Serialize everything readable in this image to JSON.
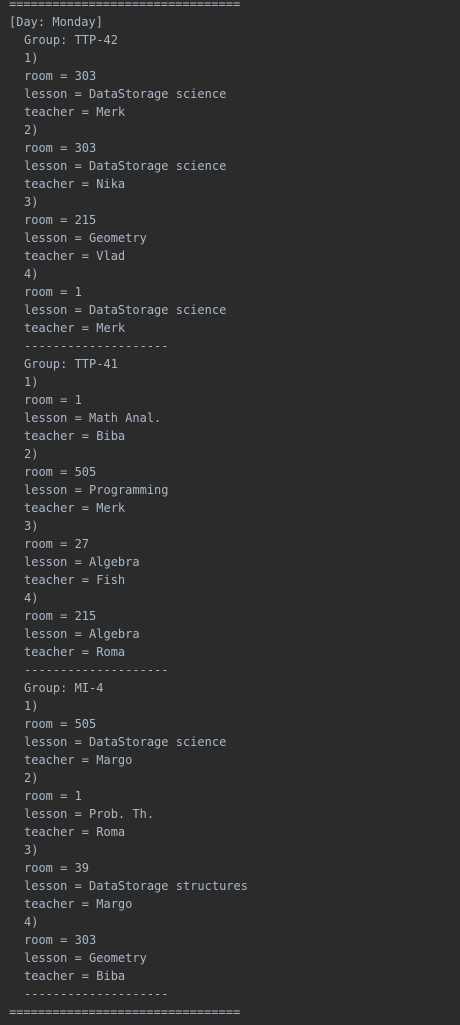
{
  "separator": "================================",
  "day_header": "[Day: Monday]",
  "groups": [
    {
      "title": "Group: TTP-42",
      "lessons": [
        {
          "num": "1)",
          "room": "room = 303",
          "lesson": "lesson = DataStorage science",
          "teacher": "teacher = Merk"
        },
        {
          "num": "2)",
          "room": "room = 303",
          "lesson": "lesson = DataStorage science",
          "teacher": "teacher = Nika"
        },
        {
          "num": "3)",
          "room": "room = 215",
          "lesson": "lesson = Geometry",
          "teacher": "teacher = Vlad"
        },
        {
          "num": "4)",
          "room": "room = 1",
          "lesson": "lesson = DataStorage science",
          "teacher": "teacher = Merk"
        }
      ],
      "divider": "--------------------"
    },
    {
      "title": "Group: TTP-41",
      "lessons": [
        {
          "num": "1)",
          "room": "room = 1",
          "lesson": "lesson = Math Anal.",
          "teacher": "teacher = Biba"
        },
        {
          "num": "2)",
          "room": "room = 505",
          "lesson": "lesson = Programming",
          "teacher": "teacher = Merk"
        },
        {
          "num": "3)",
          "room": "room = 27",
          "lesson": "lesson = Algebra",
          "teacher": "teacher = Fish"
        },
        {
          "num": "4)",
          "room": "room = 215",
          "lesson": "lesson = Algebra",
          "teacher": "teacher = Roma"
        }
      ],
      "divider": "--------------------"
    },
    {
      "title": "Group: MI-4",
      "lessons": [
        {
          "num": "1)",
          "room": "room = 505",
          "lesson": "lesson = DataStorage science",
          "teacher": "teacher = Margo"
        },
        {
          "num": "2)",
          "room": "room = 1",
          "lesson": "lesson = Prob. Th.",
          "teacher": "teacher = Roma"
        },
        {
          "num": "3)",
          "room": "room = 39",
          "lesson": "lesson = DataStorage structures",
          "teacher": "teacher = Margo"
        },
        {
          "num": "4)",
          "room": "room = 303",
          "lesson": "lesson = Geometry",
          "teacher": "teacher = Biba"
        }
      ],
      "divider": "--------------------"
    }
  ],
  "colors": {
    "background": "#2b2b2b",
    "text": "#a9b7c6"
  }
}
